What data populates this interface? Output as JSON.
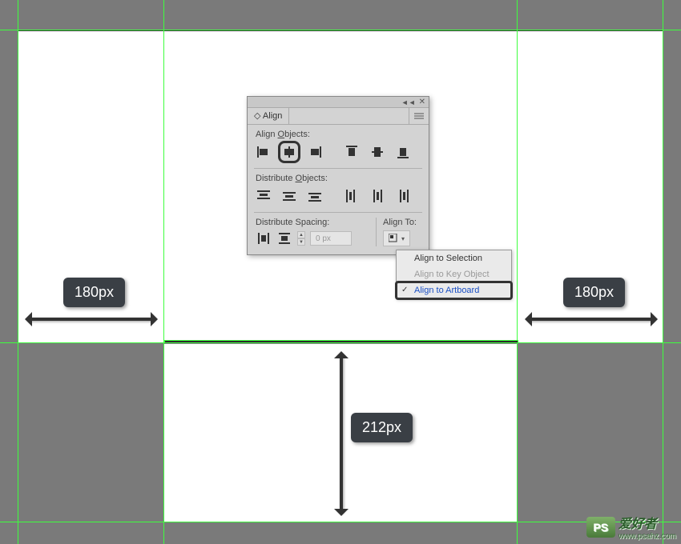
{
  "panel": {
    "title": "Align",
    "sections": {
      "align_objects": "Align Objects:",
      "distribute_objects": "Distribute Objects:",
      "distribute_spacing": "Distribute Spacing:",
      "align_to": "Align To:"
    },
    "spacing_value": "0 px",
    "align_icons": {
      "h_left": "horizontal-align-left",
      "h_center": "horizontal-align-center",
      "h_right": "horizontal-align-right",
      "v_top": "vertical-align-top",
      "v_center": "vertical-align-center",
      "v_bottom": "vertical-align-bottom"
    }
  },
  "dropdown": {
    "items": [
      {
        "label": "Align to Selection",
        "state": "normal"
      },
      {
        "label": "Align to Key Object",
        "state": "disabled"
      },
      {
        "label": "Align to Artboard",
        "state": "selected"
      }
    ]
  },
  "measurements": {
    "left_margin": "180px",
    "right_margin": "180px",
    "bottom_gap": "212px"
  },
  "watermark": {
    "logo": "PS",
    "title": "爱好者",
    "url": "www.psahz.com"
  }
}
